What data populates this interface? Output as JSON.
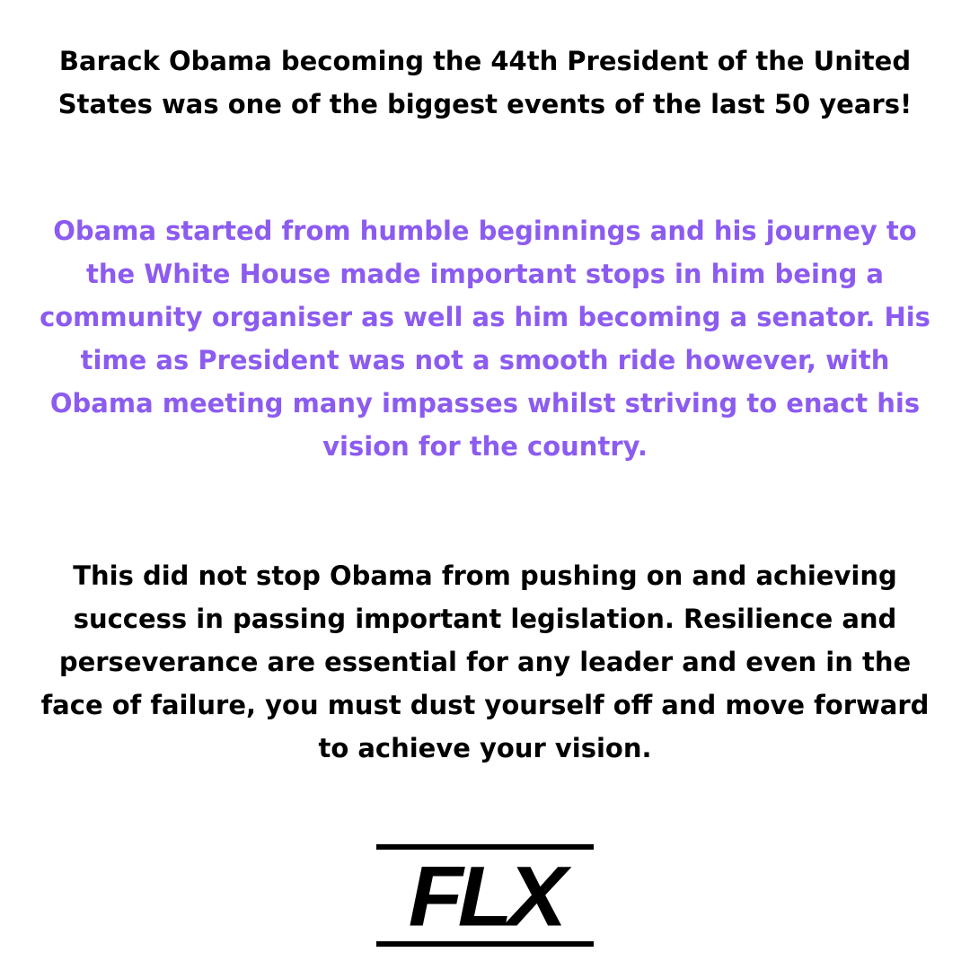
{
  "paragraphs": {
    "intro": "Barack Obama becoming the 44th President of the United States was one of the biggest events of the last 50 years!",
    "journey": "Obama started from humble beginnings and his journey to the White House made important stops in him being a community organiser as well as him becoming a senator. His time as President was not a smooth ride however, with Obama meeting many impasses whilst striving to enact his vision for the country.",
    "lesson": "This did not stop Obama from pushing on and achieving success in passing important legislation. Resilience and perseverance are essential for any leader and even in the face of failure, you must dust yourself off and move forward to achieve your vision."
  },
  "logo": {
    "text": "FLX"
  },
  "colors": {
    "background": "#ffffff",
    "text_primary": "#000000",
    "text_accent": "#8c5bf0"
  }
}
